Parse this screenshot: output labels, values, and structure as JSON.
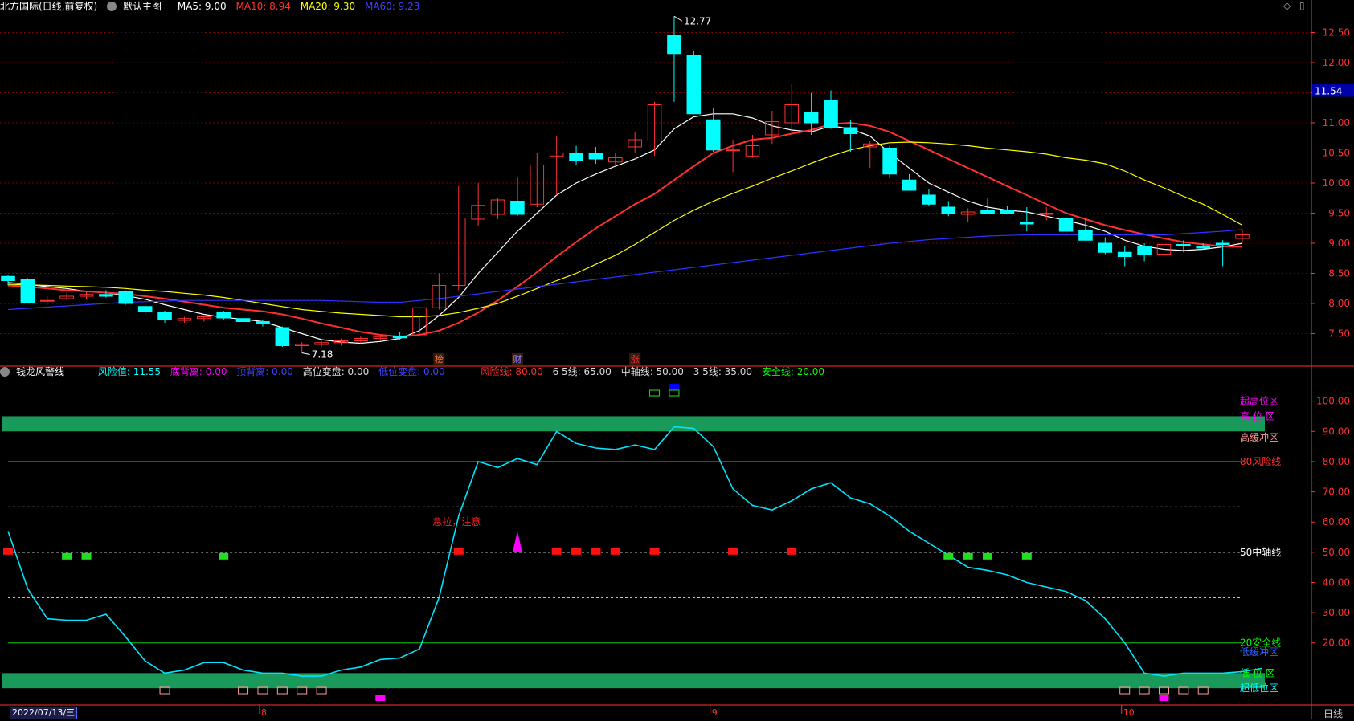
{
  "header": {
    "title": "北方国际(日线,前复权)",
    "main_chart_name": "默认主图",
    "ma": [
      {
        "label": "MA5: 9.00",
        "color": "#ffffff"
      },
      {
        "label": "MA10: 8.94",
        "color": "#ff3030"
      },
      {
        "label": "MA20: 9.30",
        "color": "#ffff00"
      },
      {
        "label": "MA60: 9.23",
        "color": "#3030ff"
      }
    ],
    "corner_icons": [
      "◇",
      "▯"
    ]
  },
  "indicator": {
    "name": "钱龙风警线",
    "values": [
      {
        "label": "风险值: 11.55",
        "color": "#00ffff"
      },
      {
        "label": "底背离: 0.00",
        "color": "#ff00ff"
      },
      {
        "label": "顶背离: 0.00",
        "color": "#3030ff"
      },
      {
        "label": "高位变盘: 0.00",
        "color": "#dddddd"
      },
      {
        "label": "低位变盘: 0.00",
        "color": "#3030ff"
      },
      {
        "label": "风险线: 80.00",
        "color": "#ff3030"
      },
      {
        "label": "6 5线: 65.00",
        "color": "#dddddd"
      },
      {
        "label": "中轴线: 50.00",
        "color": "#dddddd"
      },
      {
        "label": "3 5线: 35.00",
        "color": "#dddddd"
      },
      {
        "label": "安全线: 20.00",
        "color": "#00ff00"
      }
    ],
    "zone_labels": [
      {
        "text": "超高位区",
        "value": 100,
        "color": "#ff00ff"
      },
      {
        "text": "高 位 区",
        "value": 95,
        "color": "#ff00ff"
      },
      {
        "text": "高缓冲区",
        "value": 88,
        "color": "#ff9999"
      },
      {
        "text": "80风险线",
        "value": 80,
        "color": "#ff3030"
      },
      {
        "text": "50中轴线",
        "value": 50,
        "color": "#ffffff"
      },
      {
        "text": "20安全线",
        "value": 20,
        "color": "#00ff00"
      },
      {
        "text": "低缓冲区",
        "value": 17,
        "color": "#3060ff"
      },
      {
        "text": "低 位 区",
        "value": 10,
        "color": "#00ff00"
      },
      {
        "text": "超低位区",
        "value": 5,
        "color": "#00ffff"
      }
    ],
    "annotation": "急拉，注意"
  },
  "markers": {
    "event_labels": [
      {
        "text": "榜",
        "index": 22,
        "color": "#ff8040"
      },
      {
        "text": "财",
        "index": 26,
        "color": "#8080ff"
      },
      {
        "text": "涨",
        "index": 32,
        "color": "#ff3030"
      }
    ]
  },
  "footer": {
    "date": "2022/07/13/三",
    "period": "日线",
    "month_ticks": [
      {
        "text": "8",
        "index": 13
      },
      {
        "text": "9",
        "index": 36
      },
      {
        "text": "10",
        "index": 57
      }
    ]
  },
  "colors": {
    "up": "#ff3030",
    "down": "#00ffff",
    "grid": "#7a0000",
    "axis": "#ff3030",
    "zone": "#1a9a5a",
    "risk": "#00e5ff"
  },
  "chart_data": [
    {
      "type": "candlestick",
      "title": "北方国际(日线,前复权)",
      "ylim": [
        7.0,
        12.8
      ],
      "y_ticks": [
        12.5,
        12.0,
        11.5,
        11.0,
        10.5,
        10.0,
        9.5,
        9.0,
        8.5,
        8.0,
        7.5
      ],
      "last_price_label": "11.54",
      "high_label": "12.77",
      "low_label": "7.18",
      "ohlc": [
        [
          8.45,
          8.48,
          8.3,
          8.38
        ],
        [
          8.4,
          8.42,
          8.0,
          8.02
        ],
        [
          8.05,
          8.12,
          7.98,
          8.05
        ],
        [
          8.08,
          8.18,
          8.05,
          8.12
        ],
        [
          8.12,
          8.2,
          8.08,
          8.15
        ],
        [
          8.15,
          8.22,
          8.1,
          8.12
        ],
        [
          8.2,
          8.22,
          7.98,
          8.0
        ],
        [
          7.95,
          7.98,
          7.82,
          7.86
        ],
        [
          7.85,
          7.88,
          7.68,
          7.73
        ],
        [
          7.72,
          7.78,
          7.68,
          7.75
        ],
        [
          7.75,
          7.8,
          7.7,
          7.78
        ],
        [
          7.85,
          7.88,
          7.72,
          7.76
        ],
        [
          7.75,
          7.78,
          7.68,
          7.7
        ],
        [
          7.7,
          7.72,
          7.62,
          7.66
        ],
        [
          7.6,
          7.62,
          7.28,
          7.3
        ],
        [
          7.3,
          7.36,
          7.18,
          7.32
        ],
        [
          7.32,
          7.38,
          7.28,
          7.35
        ],
        [
          7.35,
          7.42,
          7.3,
          7.38
        ],
        [
          7.38,
          7.45,
          7.34,
          7.42
        ],
        [
          7.42,
          7.48,
          7.38,
          7.45
        ],
        [
          7.45,
          7.52,
          7.4,
          7.43
        ],
        [
          7.48,
          7.8,
          7.46,
          7.93
        ],
        [
          7.93,
          8.5,
          7.9,
          8.3
        ],
        [
          8.3,
          9.95,
          8.22,
          9.42
        ],
        [
          9.4,
          10.0,
          9.28,
          9.63
        ],
        [
          9.48,
          9.75,
          9.4,
          9.72
        ],
        [
          9.7,
          10.1,
          9.45,
          9.48
        ],
        [
          9.65,
          10.5,
          9.6,
          10.3
        ],
        [
          10.45,
          10.78,
          9.8,
          10.5
        ],
        [
          10.5,
          10.62,
          10.3,
          10.38
        ],
        [
          10.5,
          10.6,
          10.32,
          10.4
        ],
        [
          10.35,
          10.5,
          10.28,
          10.42
        ],
        [
          10.6,
          10.85,
          10.5,
          10.72
        ],
        [
          10.7,
          11.35,
          10.45,
          11.3
        ],
        [
          12.45,
          12.77,
          11.35,
          12.15
        ],
        [
          12.12,
          12.2,
          11.15,
          11.15
        ],
        [
          11.05,
          11.25,
          10.52,
          10.55
        ],
        [
          10.55,
          10.72,
          10.18,
          10.55
        ],
        [
          10.45,
          10.8,
          10.42,
          10.62
        ],
        [
          10.8,
          11.2,
          10.65,
          11.02
        ],
        [
          11.0,
          11.65,
          10.85,
          11.3
        ],
        [
          11.18,
          11.5,
          10.8,
          11.0
        ],
        [
          11.38,
          11.54,
          10.9,
          10.92
        ],
        [
          10.92,
          11.05,
          10.52,
          10.82
        ],
        [
          10.6,
          10.7,
          10.25,
          10.65
        ],
        [
          10.58,
          10.62,
          10.08,
          10.15
        ],
        [
          10.05,
          10.15,
          9.9,
          9.88
        ],
        [
          9.8,
          9.9,
          9.62,
          9.65
        ],
        [
          9.6,
          9.7,
          9.45,
          9.5
        ],
        [
          9.48,
          9.58,
          9.35,
          9.52
        ],
        [
          9.55,
          9.75,
          9.48,
          9.5
        ],
        [
          9.54,
          9.62,
          9.48,
          9.5
        ],
        [
          9.35,
          9.6,
          9.2,
          9.32
        ],
        [
          9.48,
          9.6,
          9.38,
          9.5
        ],
        [
          9.42,
          9.52,
          9.12,
          9.2
        ],
        [
          9.22,
          9.4,
          9.12,
          9.05
        ],
        [
          9.0,
          9.1,
          8.82,
          8.85
        ],
        [
          8.85,
          8.95,
          8.62,
          8.78
        ],
        [
          8.95,
          9.0,
          8.7,
          8.82
        ],
        [
          8.82,
          9.02,
          8.8,
          8.98
        ],
        [
          8.98,
          9.05,
          8.85,
          8.96
        ],
        [
          8.95,
          9.0,
          8.9,
          8.92
        ],
        [
          9.0,
          9.05,
          8.62,
          8.98
        ],
        [
          9.08,
          9.24,
          9.02,
          9.14
        ]
      ],
      "series": [
        {
          "name": "MA5",
          "color": "#ffffff",
          "values": [
            8.35,
            8.32,
            8.28,
            8.25,
            8.2,
            8.18,
            8.13,
            8.07,
            7.98,
            7.9,
            7.82,
            7.77,
            7.74,
            7.7,
            7.6,
            7.5,
            7.4,
            7.36,
            7.34,
            7.37,
            7.42,
            7.55,
            7.8,
            8.1,
            8.5,
            8.85,
            9.2,
            9.5,
            9.8,
            10.0,
            10.15,
            10.28,
            10.4,
            10.55,
            10.9,
            11.1,
            11.15,
            11.15,
            11.08,
            10.95,
            10.88,
            10.85,
            10.95,
            10.9,
            10.78,
            10.5,
            10.25,
            10.0,
            9.85,
            9.7,
            9.6,
            9.55,
            9.52,
            9.45,
            9.38,
            9.3,
            9.2,
            9.05,
            8.95,
            8.9,
            8.88,
            8.9,
            8.94,
            9.0
          ]
        },
        {
          "name": "MA10",
          "color": "#ff3030",
          "values": [
            8.3,
            8.28,
            8.25,
            8.22,
            8.2,
            8.18,
            8.16,
            8.12,
            8.08,
            8.03,
            7.98,
            7.93,
            7.9,
            7.87,
            7.82,
            7.75,
            7.67,
            7.6,
            7.53,
            7.48,
            7.45,
            7.48,
            7.55,
            7.68,
            7.85,
            8.05,
            8.28,
            8.52,
            8.78,
            9.02,
            9.25,
            9.45,
            9.65,
            9.82,
            10.05,
            10.28,
            10.5,
            10.62,
            10.72,
            10.75,
            10.82,
            10.88,
            10.98,
            11.0,
            10.95,
            10.85,
            10.7,
            10.55,
            10.4,
            10.25,
            10.1,
            9.95,
            9.8,
            9.65,
            9.5,
            9.4,
            9.3,
            9.22,
            9.15,
            9.08,
            9.02,
            8.98,
            8.95,
            8.94
          ]
        },
        {
          "name": "MA20",
          "color": "#ffff00",
          "values": [
            8.32,
            8.31,
            8.3,
            8.29,
            8.28,
            8.27,
            8.25,
            8.22,
            8.2,
            8.17,
            8.14,
            8.1,
            8.05,
            8.0,
            7.95,
            7.9,
            7.87,
            7.84,
            7.82,
            7.8,
            7.78,
            7.78,
            7.8,
            7.85,
            7.92,
            8.0,
            8.12,
            8.25,
            8.38,
            8.5,
            8.65,
            8.8,
            8.98,
            9.18,
            9.38,
            9.55,
            9.7,
            9.83,
            9.95,
            10.08,
            10.2,
            10.33,
            10.45,
            10.55,
            10.62,
            10.67,
            10.68,
            10.67,
            10.65,
            10.62,
            10.58,
            10.55,
            10.52,
            10.48,
            10.42,
            10.38,
            10.32,
            10.2,
            10.05,
            9.92,
            9.78,
            9.65,
            9.48,
            9.3
          ]
        },
        {
          "name": "MA60",
          "color": "#3030ff",
          "values": [
            7.9,
            7.92,
            7.94,
            7.96,
            7.98,
            8.0,
            8.02,
            8.03,
            8.04,
            8.05,
            8.05,
            8.05,
            8.05,
            8.05,
            8.05,
            8.05,
            8.05,
            8.04,
            8.03,
            8.02,
            8.02,
            8.05,
            8.08,
            8.12,
            8.16,
            8.2,
            8.24,
            8.28,
            8.32,
            8.36,
            8.4,
            8.44,
            8.48,
            8.52,
            8.56,
            8.6,
            8.64,
            8.68,
            8.72,
            8.76,
            8.8,
            8.84,
            8.88,
            8.92,
            8.96,
            9.0,
            9.03,
            9.06,
            9.08,
            9.1,
            9.12,
            9.13,
            9.14,
            9.14,
            9.14,
            9.14,
            9.14,
            9.14,
            9.14,
            9.14,
            9.16,
            9.18,
            9.2,
            9.23
          ]
        }
      ]
    },
    {
      "type": "line",
      "title": "钱龙风警线",
      "ylim": [
        0,
        110
      ],
      "y_ticks": [
        100.0,
        90.0,
        80.0,
        70.0,
        60.0,
        50.0,
        40.0,
        30.0,
        20.0
      ],
      "hlines": [
        {
          "value": 80,
          "style": "solid",
          "color": "#ff3030"
        },
        {
          "value": 65,
          "style": "dashed",
          "color": "#ffffff"
        },
        {
          "value": 50,
          "style": "dashed",
          "color": "#ffffff"
        },
        {
          "value": 35,
          "style": "dashed",
          "color": "#ffffff"
        },
        {
          "value": 20,
          "style": "solid",
          "color": "#00cc00"
        }
      ],
      "bands": [
        [
          90,
          95
        ],
        [
          5,
          10
        ]
      ],
      "series": [
        {
          "name": "风险值",
          "color": "#00e5ff",
          "values": [
            57,
            38,
            28,
            27.5,
            27.5,
            29.5,
            22,
            14,
            10,
            11,
            13.5,
            13.5,
            11,
            10,
            10,
            9,
            9,
            11,
            12,
            14.5,
            15,
            18,
            35,
            62,
            80,
            78,
            81,
            79,
            90,
            86,
            84.5,
            84,
            85.5,
            84,
            91.5,
            91,
            85,
            71,
            65.5,
            64,
            67,
            71,
            73,
            68,
            66,
            62,
            57,
            53,
            49,
            45,
            44,
            42.5,
            40,
            38.5,
            37,
            34,
            28,
            20,
            10,
            9,
            10,
            10,
            10,
            10.5,
            11.55
          ]
        }
      ]
    }
  ]
}
